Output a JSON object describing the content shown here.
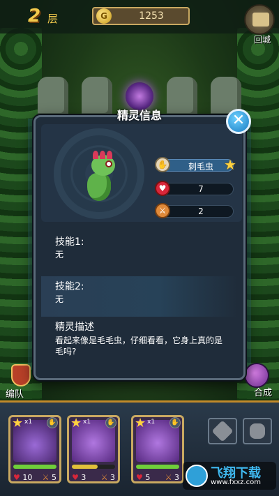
{
  "hud": {
    "floor_number": "2",
    "floor_label": "层",
    "coins": "1253",
    "coin_icon": "coin-icon",
    "return_label": "回城",
    "team_label": "编队",
    "merge_label": "合成"
  },
  "modal": {
    "title": "精灵信息",
    "close_glyph": "✕",
    "name": "刺毛虫",
    "hp": "7",
    "attack": "2",
    "skill1_title": "技能1:",
    "skill1_value": "无",
    "skill2_title": "技能2:",
    "skill2_value": "无",
    "desc_title": "精灵描述",
    "desc_text": "看起来像是毛毛虫，仔细看看，它身上真的是毛吗?"
  },
  "cards": [
    {
      "mult": "x1",
      "hp": "10",
      "atk": "5",
      "bar_pct": 100
    },
    {
      "mult": "x1",
      "hp": "3",
      "atk": "3",
      "bar_pct": 60
    },
    {
      "mult": "x1",
      "hp": "5",
      "atk": "3",
      "bar_pct": 100
    }
  ],
  "watermark": {
    "t1": "飞翔下载",
    "t2": "www.fxxz.com"
  },
  "colors": {
    "accent_gold": "#c9a961",
    "close_blue": "#1a7cc2",
    "hp_red": "#d9263a"
  }
}
